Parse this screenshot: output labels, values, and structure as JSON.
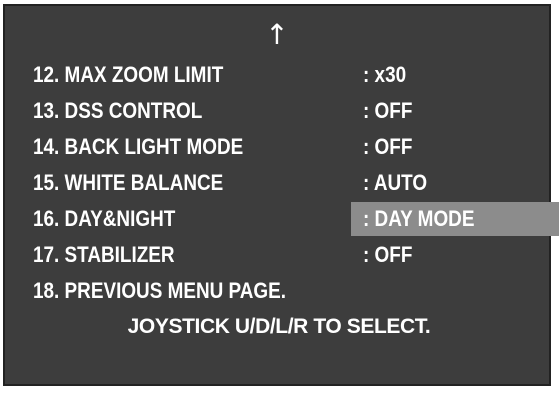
{
  "osd": {
    "scroll_up_glyph": "↑",
    "items": [
      {
        "label": "12. MAX ZOOM LIMIT",
        "value": ": x30"
      },
      {
        "label": "13. DSS CONTROL",
        "value": ": OFF"
      },
      {
        "label": "14. BACK LIGHT MODE",
        "value": ": OFF"
      },
      {
        "label": "15. WHITE BALANCE",
        "value": ": AUTO"
      },
      {
        "label": "16. DAY&NIGHT",
        "value": ": DAY MODE"
      },
      {
        "label": "17. STABILIZER",
        "value": ": OFF"
      }
    ],
    "previous_page_label": "18. PREVIOUS MENU PAGE.",
    "instruction": "JOYSTICK U/D/L/R TO SELECT.",
    "highlighted_item_index": 4,
    "colors": {
      "background": "#3d3d3d",
      "text": "#ffffff",
      "highlight": "#8c8c8c"
    }
  }
}
